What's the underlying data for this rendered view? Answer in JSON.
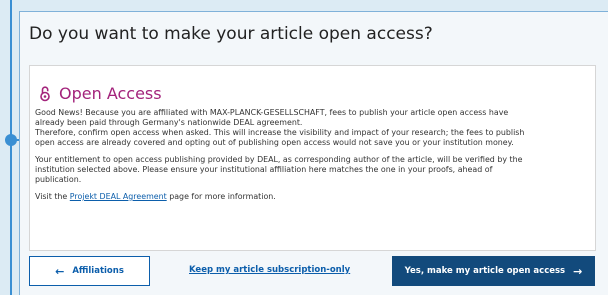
{
  "card": {
    "title": "Do you want to make your article open access?"
  },
  "open_access": {
    "heading": "Open Access",
    "icon": "open-lock-icon",
    "accent_color": "#a3237b",
    "paragraph_1_lines": [
      "Good News! Because you are affiliated with MAX-PLANCK-GESELLSCHAFT, fees to publish your article open access have",
      "already been paid through Germany's nationwide DEAL agreement.",
      "Therefore, confirm open access when asked. This will increase the visibility and impact of your research; the fees to publish",
      "open access are already covered and opting out of publishing open access would not save you or your institution money."
    ],
    "paragraph_2_lines": [
      "Your entitlement to open access publishing provided by DEAL, as corresponding author of the article, will be verified by the",
      "institution selected above. Please ensure your institutional affiliation here matches the one in your proofs, ahead of",
      "publication."
    ],
    "visit_prefix": "Visit the ",
    "visit_link": "Projekt DEAL Agreement",
    "visit_suffix": " page for more information."
  },
  "actions": {
    "back_label": "Affiliations",
    "back_icon": "arrow-left-icon",
    "keep_subscription_label": "Keep my article subscription-only",
    "confirm_label": "Yes, make my article open access",
    "confirm_icon": "arrow-right-icon",
    "primary_color": "#124a7c",
    "link_color": "#0c5eab"
  }
}
